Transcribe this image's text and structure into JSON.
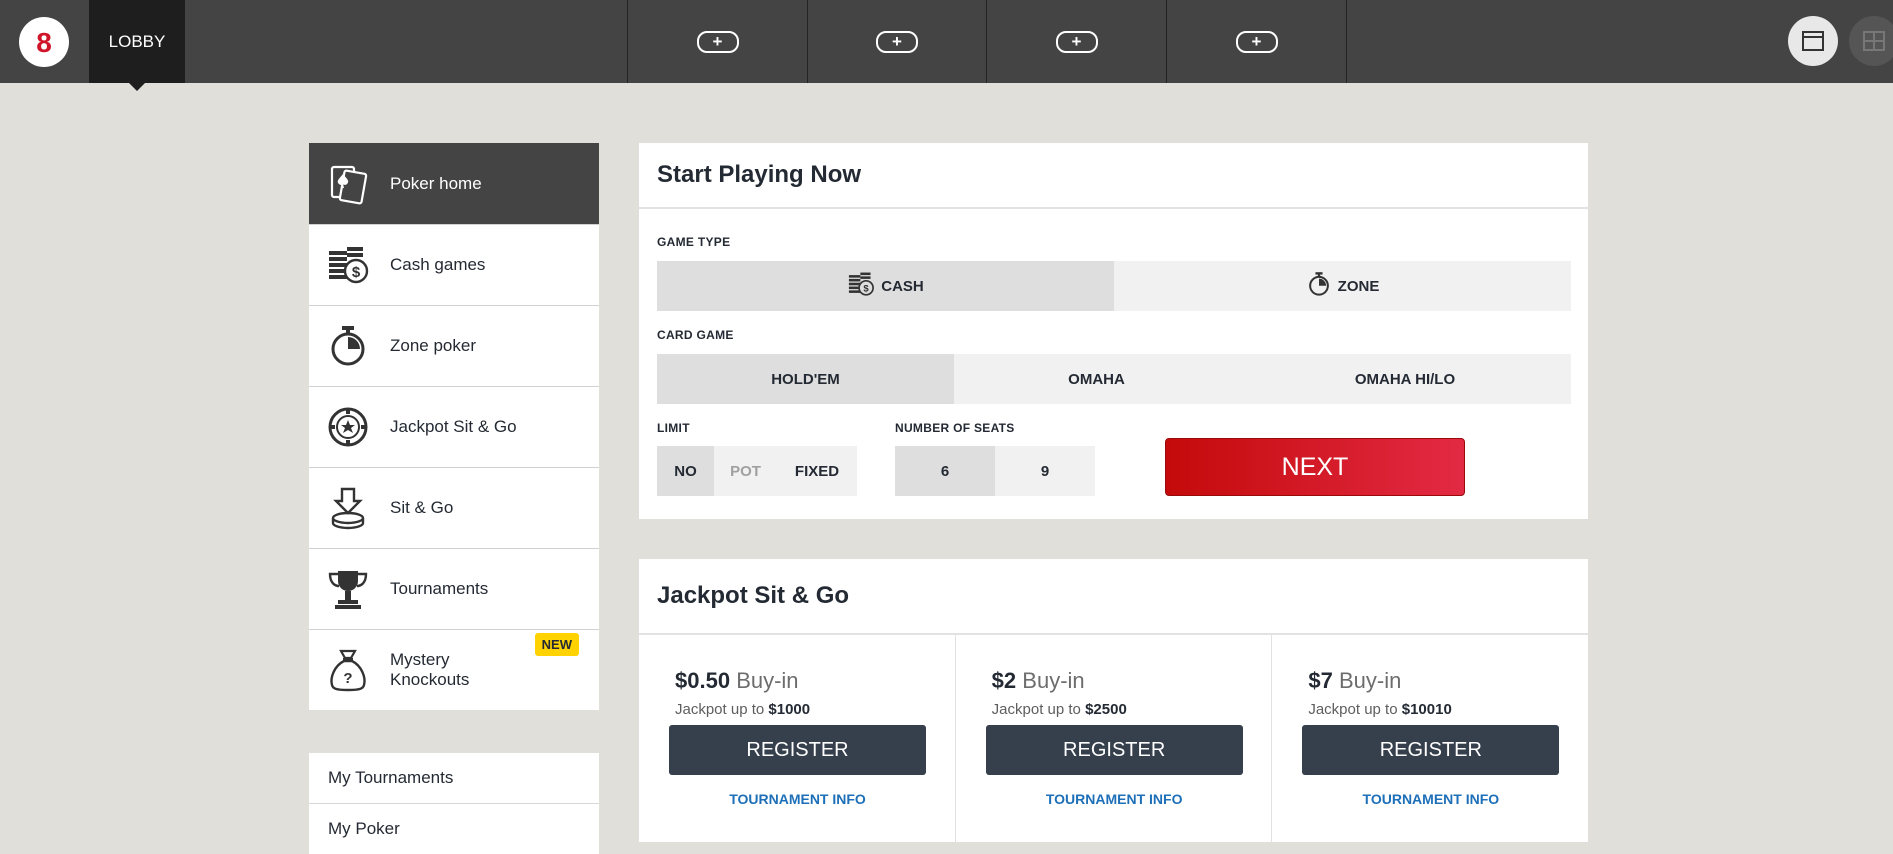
{
  "topbar": {
    "logo_letter": "8",
    "lobby_label": "LOBBY",
    "table_slots": [
      "+",
      "+",
      "+",
      "+"
    ]
  },
  "sidebar": {
    "items": [
      {
        "label": "Poker home",
        "icon": "cards-icon",
        "active": true
      },
      {
        "label": "Cash games",
        "icon": "chips-icon"
      },
      {
        "label": "Zone poker",
        "icon": "stopwatch-icon"
      },
      {
        "label": "Jackpot Sit & Go",
        "icon": "star-chip-icon"
      },
      {
        "label": "Sit & Go",
        "icon": "download-chip-icon"
      },
      {
        "label": "Tournaments",
        "icon": "trophy-icon"
      },
      {
        "label": "Mystery Knockouts",
        "icon": "money-bag-icon",
        "badge": "NEW"
      }
    ],
    "links": [
      "My Tournaments",
      "My Poker"
    ]
  },
  "start": {
    "title": "Start Playing Now",
    "game_type_label": "GAME TYPE",
    "game_types": [
      "CASH",
      "ZONE"
    ],
    "card_game_label": "CARD GAME",
    "card_games": [
      "HOLD'EM",
      "OMAHA",
      "OMAHA HI/LO"
    ],
    "limit_label": "LIMIT",
    "limits": [
      "NO",
      "POT",
      "FIXED"
    ],
    "seats_label": "NUMBER OF SEATS",
    "seats": [
      "6",
      "9"
    ],
    "next_label": "NEXT"
  },
  "jackpot": {
    "title": "Jackpot Sit & Go",
    "buyin_word": "Buy-in",
    "jackpot_prefix": "Jackpot up to",
    "register_label": "REGISTER",
    "info_label": "TOURNAMENT INFO",
    "tiers": [
      {
        "price": "$0.50",
        "jackpot": "$1000"
      },
      {
        "price": "$2",
        "jackpot": "$2500"
      },
      {
        "price": "$7",
        "jackpot": "$10010"
      }
    ]
  },
  "colors": {
    "topbar": "#444444",
    "accent_red": "#d0152a",
    "register": "#363f4c",
    "link_blue": "#1d6fb8",
    "badge_yellow": "#ffd200"
  }
}
